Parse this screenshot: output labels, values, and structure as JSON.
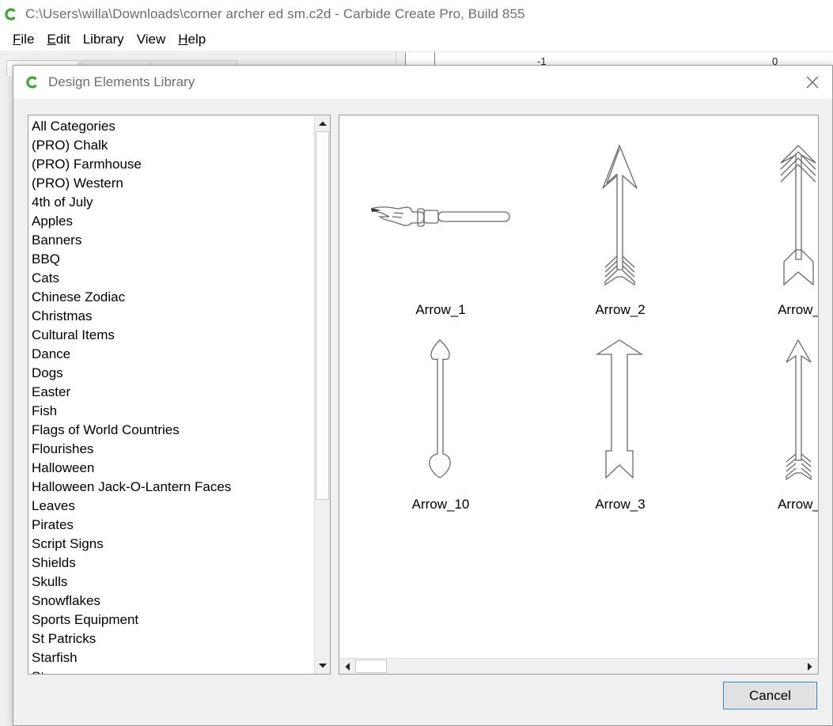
{
  "app": {
    "title": "C:\\Users\\willa\\Downloads\\corner archer ed sm.c2d - Carbide Create Pro, Build 855",
    "logo_icon": "carbide-logo-icon",
    "brand_color": "#3aaa35"
  },
  "menubar": {
    "items": [
      {
        "label": "File",
        "mnemonic": "F",
        "rest": "ile"
      },
      {
        "label": "Edit",
        "mnemonic": "E",
        "rest": "dit"
      },
      {
        "label": "Library",
        "mnemonic": "",
        "rest": "Library"
      },
      {
        "label": "View",
        "mnemonic": "",
        "rest": "View"
      },
      {
        "label": "Help",
        "mnemonic": "H",
        "rest": "elp"
      }
    ]
  },
  "background": {
    "ruler_labels": [
      "-1",
      "0"
    ]
  },
  "dialog": {
    "title": "Design Elements Library",
    "close_icon": "close-icon",
    "categories": [
      "All Categories",
      "(PRO) Chalk",
      "(PRO) Farmhouse",
      "(PRO) Western",
      "4th of July",
      "Apples",
      "Banners",
      "BBQ",
      "Cats",
      "Chinese Zodiac",
      "Christmas",
      "Cultural Items",
      "Dance",
      "Dogs",
      "Easter",
      "Fish",
      "Flags of World Countries",
      "Flourishes",
      "Halloween",
      "Halloween Jack-O-Lantern Faces",
      "Leaves",
      "Pirates",
      "Script Signs",
      "Shields",
      "Skulls",
      "Snowflakes",
      "Sports Equipment",
      "St Patricks",
      "Starfish",
      "Stars"
    ],
    "elements": [
      {
        "label": "Arrow_1",
        "icon": "pointing-hand-arrow-icon"
      },
      {
        "label": "Arrow_2",
        "icon": "feathered-arrow-icon"
      },
      {
        "label": "Arrow_",
        "icon": "chevron-fletched-arrow-icon"
      },
      {
        "label": "Arrow_10",
        "icon": "heart-tail-arrow-icon"
      },
      {
        "label": "Arrow_3",
        "icon": "block-arrow-icon"
      },
      {
        "label": "Arrow_",
        "icon": "slim-fletched-arrow-icon"
      }
    ],
    "cancel_label": "Cancel"
  }
}
